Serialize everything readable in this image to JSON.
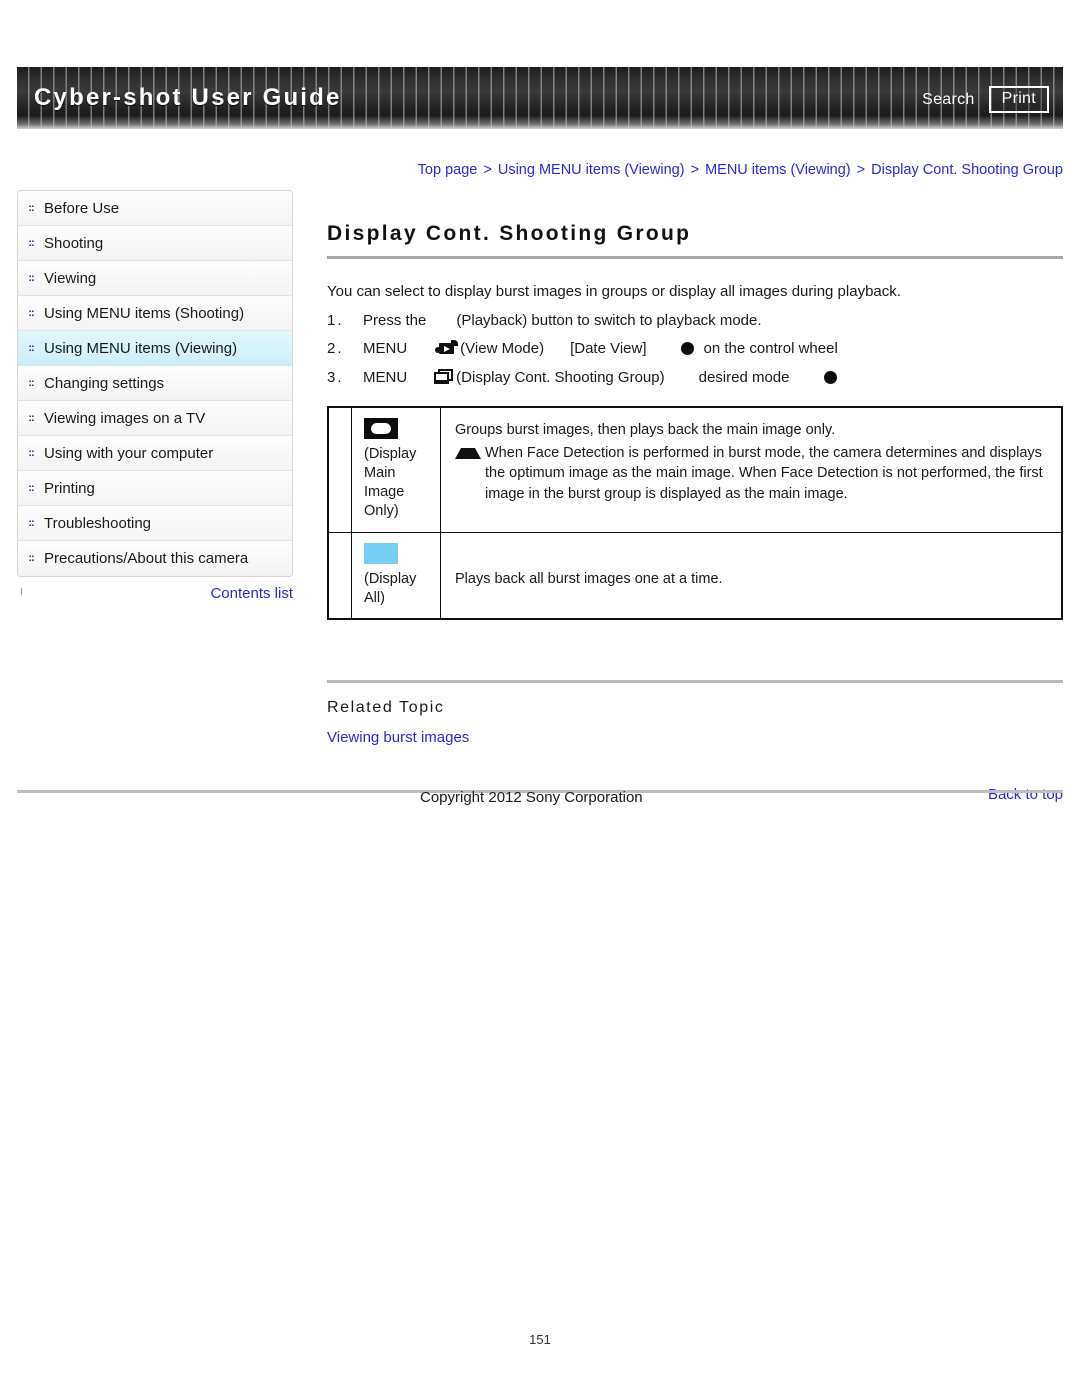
{
  "header": {
    "title": "Cyber-shot User Guide",
    "search_label": "Search",
    "print_label": "Print"
  },
  "breadcrumb": {
    "separator": ">",
    "items": [
      "Top page",
      "Using MENU items (Viewing)",
      "MENU items (Viewing)",
      "Display Cont. Shooting Group"
    ]
  },
  "sidebar": {
    "items": [
      {
        "label": "Before Use",
        "bullet": "::",
        "active": false
      },
      {
        "label": "Shooting",
        "bullet": "::",
        "active": false
      },
      {
        "label": "Viewing",
        "bullet": "::",
        "active": false
      },
      {
        "label": "Using MENU items (Shooting)",
        "bullet": "::",
        "active": false
      },
      {
        "label": "Using MENU items (Viewing)",
        "bullet": "::",
        "active": true
      },
      {
        "label": "Changing settings",
        "bullet": "::",
        "active": false
      },
      {
        "label": "Viewing images on a TV",
        "bullet": "::",
        "active": false
      },
      {
        "label": "Using with your computer",
        "bullet": "::",
        "active": false
      },
      {
        "label": "Printing",
        "bullet": "::",
        "active": false
      },
      {
        "label": "Troubleshooting",
        "bullet": "::",
        "active": false
      },
      {
        "label": "Precautions/About this camera",
        "bullet": "::",
        "active": false
      }
    ],
    "contents_link": "Contents list"
  },
  "main": {
    "title": "Display Cont. Shooting Group",
    "intro": "You can select to display burst images in groups or display all images during playback.",
    "steps": [
      {
        "number": "1.",
        "text_before": "Press the",
        "text_after": "(Playback) button to switch to playback mode.",
        "icon": "playback-icon"
      },
      {
        "number": "2.",
        "menu_label": "MENU",
        "icon": "view-mode-icon",
        "part1": "(View Mode)",
        "part2": "[Date View]",
        "part3": "on the control wheel"
      },
      {
        "number": "3.",
        "menu_label": "MENU",
        "icon": "display-cont-shooting-group-icon",
        "part1": "(Display Cont. Shooting Group)",
        "part2": "desired mode"
      }
    ],
    "table": {
      "rows": [
        {
          "icon": "display-main-image-only-icon",
          "icon_color": "#0d0d0d",
          "label": "(Display Main Image Only)",
          "description": "Groups burst images, then plays back the main image only.",
          "note": "When Face Detection is performed in burst mode, the camera determines and displays the optimum image as the main image. When Face Detection is not performed, the first image in the burst group is displayed as the main image."
        },
        {
          "icon": "display-all-icon",
          "icon_color": "#77cdf2",
          "label": "(Display All)",
          "description": "Plays back all burst images one at a time.",
          "note": ""
        }
      ]
    },
    "related": {
      "heading": "Related Topic",
      "links": [
        "Viewing burst images"
      ]
    },
    "back_to_top": "Back to top"
  },
  "footer": {
    "copyright": "Copyright 2012 Sony Corporation",
    "page_number": "151"
  },
  "colors": {
    "link": "#2a2ad0",
    "active_nav": "#cceef8",
    "display_all_swatch": "#77cdf2"
  }
}
